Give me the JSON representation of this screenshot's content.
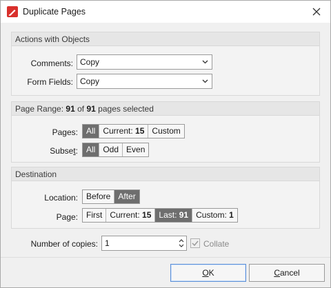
{
  "window": {
    "title": "Duplicate Pages",
    "close_icon": "close-icon"
  },
  "objects": {
    "heading": "Actions with Objects",
    "comments_label": "Comments:",
    "comments_value": "Copy",
    "form_fields_label": "Form Fields:",
    "form_fields_value": "Copy"
  },
  "page_range": {
    "prefix": "Page Range:",
    "selected": "91",
    "of": "of",
    "total": "91",
    "suffix": "pages selected",
    "pages_label": "Pages:",
    "pages_options": [
      "All",
      "Current:",
      "15",
      "Custom"
    ],
    "pages_selected": "All",
    "subset_label": "Subset:",
    "subset_options": [
      "All",
      "Odd",
      "Even"
    ],
    "subset_selected": "All"
  },
  "destination": {
    "heading": "Destination",
    "location_label": "Location:",
    "location_options": [
      "Before",
      "After"
    ],
    "location_selected": "After",
    "page_label": "Page:",
    "page_first": "First",
    "page_current_label": "Current:",
    "page_current_value": "15",
    "page_last_label": "Last:",
    "page_last_value": "91",
    "page_custom_label": "Custom:",
    "page_custom_value": "1",
    "page_selected": "Last"
  },
  "copies": {
    "label": "Number of copies:",
    "value": "1",
    "collate_label": "Collate",
    "collate_checked": true
  },
  "buttons": {
    "ok": "OK",
    "cancel": "Cancel"
  },
  "colors": {
    "active_segment": "#6e6e6e",
    "group_header": "#e6e6e6",
    "app_icon": "#d9302c"
  }
}
